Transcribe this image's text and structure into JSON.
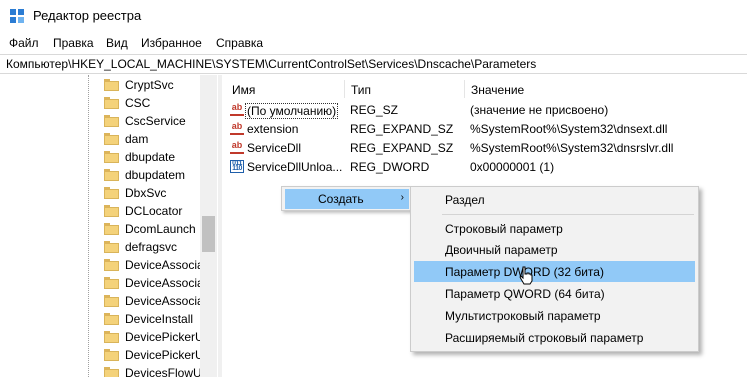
{
  "window": {
    "title": "Редактор реестра"
  },
  "menu": [
    "Файл",
    "Правка",
    "Вид",
    "Избранное",
    "Справка"
  ],
  "address": {
    "path": "Компьютер\\HKEY_LOCAL_MACHINE\\SYSTEM\\CurrentControlSet\\Services\\Dnscache\\Parameters"
  },
  "tree": {
    "items": [
      "CryptSvc",
      "CSC",
      "CscService",
      "dam",
      "dbupdate",
      "dbupdatem",
      "DbxSvc",
      "DCLocator",
      "DcomLaunch",
      "defragsvc",
      "DeviceAssocia",
      "DeviceAssocia",
      "DeviceAssocia",
      "DeviceInstall",
      "DevicePickerU",
      "DevicePickerU",
      "DevicesFlowUs"
    ]
  },
  "list": {
    "columns": [
      "Имя",
      "Тип",
      "Значение"
    ],
    "rows": [
      {
        "icon": "string-value-icon",
        "name": "(По умолчанию)",
        "type": "REG_SZ",
        "value": "(значение не присвоено)"
      },
      {
        "icon": "string-value-icon",
        "name": "extension",
        "type": "REG_EXPAND_SZ",
        "value": "%SystemRoot%\\System32\\dnsext.dll"
      },
      {
        "icon": "string-value-icon",
        "name": "ServiceDll",
        "type": "REG_EXPAND_SZ",
        "value": "%SystemRoot%\\System32\\dnsrslvr.dll"
      },
      {
        "icon": "binary-value-icon",
        "name": "ServiceDllUnloa...",
        "type": "REG_DWORD",
        "value": "0x00000001 (1)"
      }
    ]
  },
  "context_menu": {
    "item": "Создать",
    "arrow": "›"
  },
  "submenu": {
    "items": [
      "Раздел",
      "Строковый параметр",
      "Двоичный параметр",
      "Параметр DWORD (32 бита)",
      "Параметр QWORD (64 бита)",
      "Мультистроковый параметр",
      "Расширяемый строковый параметр"
    ],
    "highlighted_index": 3
  },
  "colors": {
    "highlight": "#91c9f7",
    "folder": "#f4d27a",
    "menu_bg": "#f2f2f2"
  }
}
